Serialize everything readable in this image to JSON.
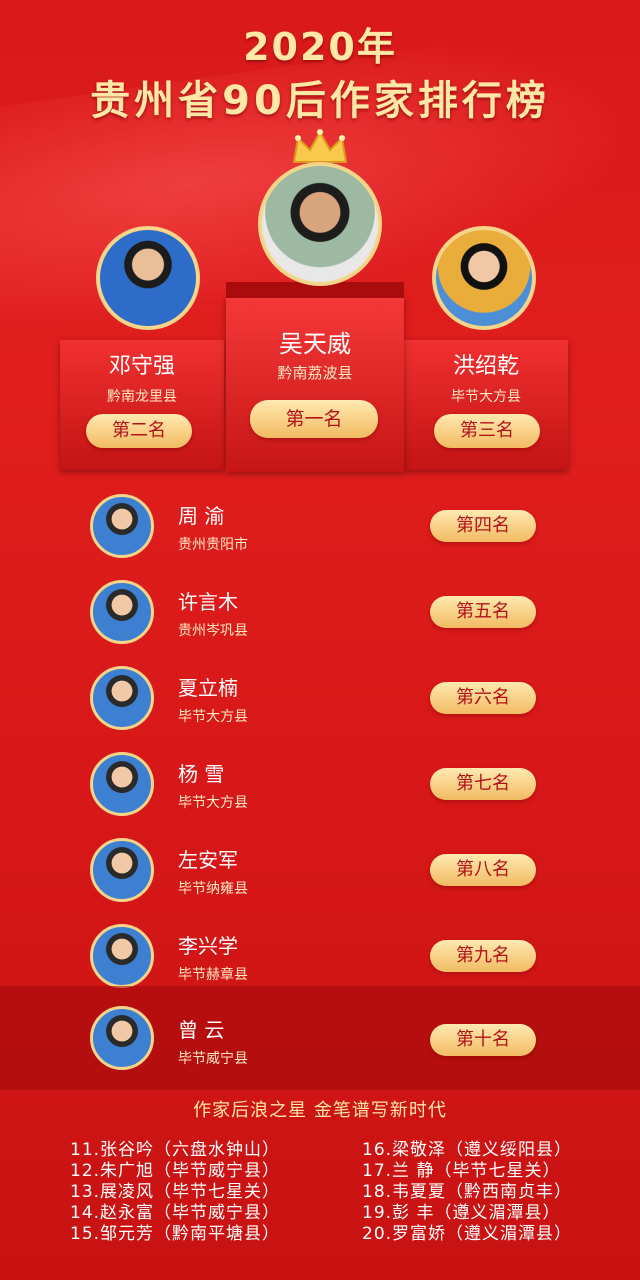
{
  "header": {
    "year_title": "2020年",
    "main_title": "贵州省90后作家排行榜"
  },
  "podium": {
    "first": {
      "name": "吴天威",
      "place": "黔南荔波县",
      "rank": "第一名"
    },
    "second": {
      "name": "邓守强",
      "place": "黔南龙里县",
      "rank": "第二名"
    },
    "third": {
      "name": "洪绍乾",
      "place": "毕节大方县",
      "rank": "第三名"
    }
  },
  "rows": [
    {
      "name": "周  渝",
      "place": "贵州贵阳市",
      "rank": "第四名"
    },
    {
      "name": "许言木",
      "place": "贵州岑巩县",
      "rank": "第五名"
    },
    {
      "name": "夏立楠",
      "place": "毕节大方县",
      "rank": "第六名"
    },
    {
      "name": "杨  雪",
      "place": "毕节大方县",
      "rank": "第七名"
    },
    {
      "name": "左安军",
      "place": "毕节纳雍县",
      "rank": "第八名"
    },
    {
      "name": "李兴学",
      "place": "毕节赫章县",
      "rank": "第九名"
    },
    {
      "name": "曾  云",
      "place": "毕节威宁县",
      "rank": "第十名"
    }
  ],
  "slogan": "作家后浪之星  金笔谱写新时代",
  "list_left": [
    "11.张谷吟（六盘水钟山）",
    "12.朱广旭（毕节威宁县）",
    "13.展凌风（毕节七星关）",
    "14.赵永富（毕节威宁县）",
    "15.邹元芳（黔南平塘县）"
  ],
  "list_right": [
    "16.梁敬泽（遵义绥阳县）",
    "17.兰  静（毕节七星关）",
    "18.韦夏夏（黔西南贞丰）",
    "19.彭  丰（遵义湄潭县）",
    "20.罗富娇（遵义湄潭县）"
  ],
  "colors": {
    "accent_gold": "#f6d48a",
    "background_red": "#d91a1a"
  }
}
